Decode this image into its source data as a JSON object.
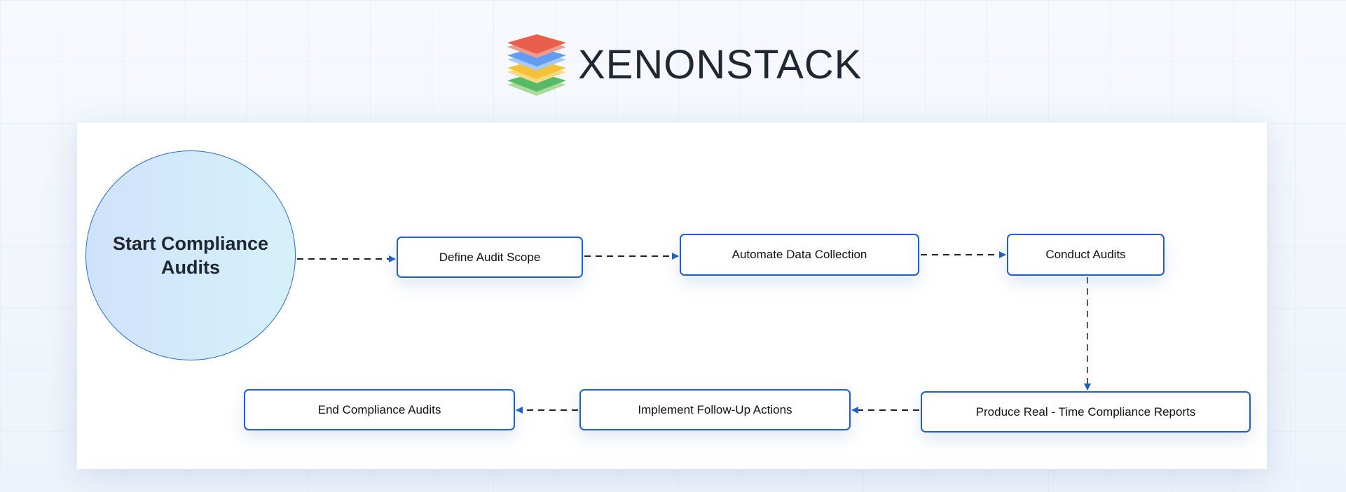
{
  "logo": {
    "text": "XENONSTACK",
    "colors": [
      "#e8442e",
      "#4a8ef0",
      "#f5b915",
      "#3cb04a"
    ]
  },
  "diagram": {
    "start": "Start Compliance Audits",
    "steps": [
      "Define Audit Scope",
      "Automate Data Collection",
      "Conduct Audits",
      "Produce Real - Time Compliance Reports",
      "Implement Follow-Up Actions",
      "End Compliance Audits"
    ],
    "colors": {
      "border": "#1f5fc9",
      "arrow": "#1f5fc9",
      "line": "#222222"
    }
  }
}
